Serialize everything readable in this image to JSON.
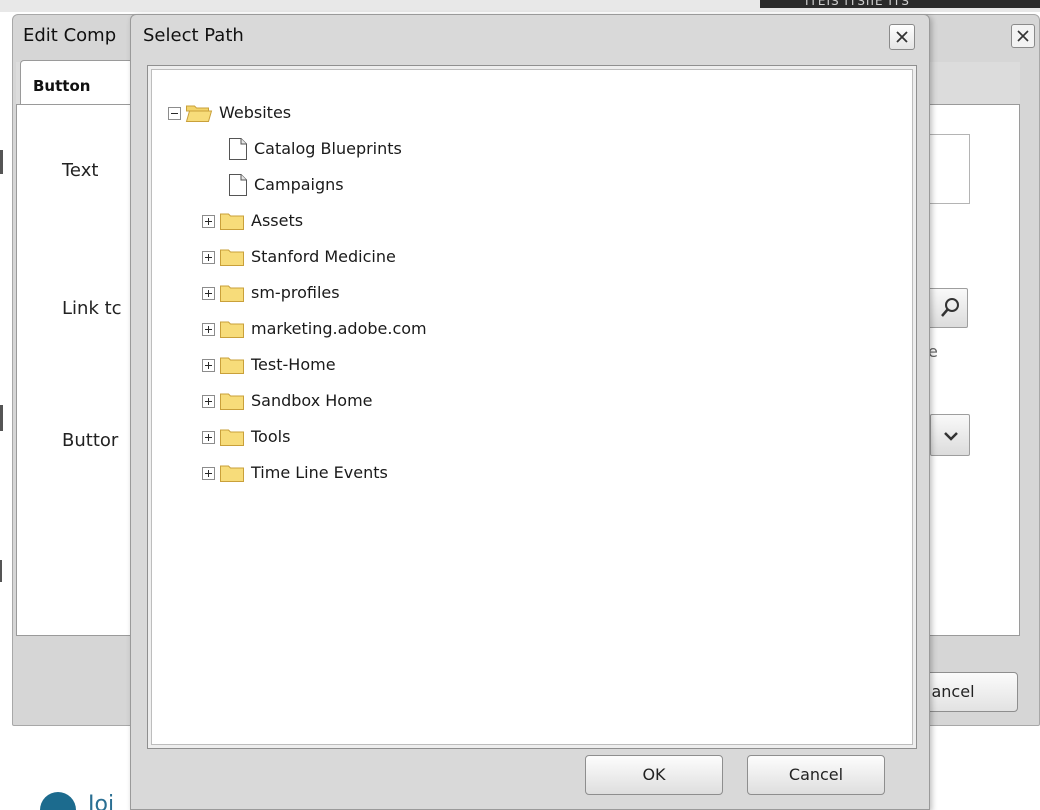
{
  "page": {
    "top_strip_text": "ITEIS ITSIIE     ITS",
    "footer_link": "Joi"
  },
  "edit_dialog": {
    "title": "Edit Comp",
    "tab_label": "Button",
    "fields": {
      "text_label": "Text",
      "link_label": "Link tc",
      "button_label": "Buttor"
    },
    "hint_fragment": "e",
    "cancel_label": "ancel"
  },
  "select_path_dialog": {
    "title": "Select Path",
    "tree": {
      "root": {
        "label": "Websites",
        "expanded": true,
        "icon": "folder-open-icon"
      },
      "pages": [
        {
          "label": "Catalog Blueprints",
          "icon": "page-icon"
        },
        {
          "label": "Campaigns",
          "icon": "page-icon"
        }
      ],
      "folders": [
        {
          "label": "Assets",
          "icon": "folder-icon"
        },
        {
          "label": "Stanford Medicine",
          "icon": "folder-icon"
        },
        {
          "label": "sm-profiles",
          "icon": "folder-icon"
        },
        {
          "label": "marketing.adobe.com",
          "icon": "folder-icon"
        },
        {
          "label": "Test-Home",
          "icon": "folder-icon"
        },
        {
          "label": "Sandbox Home",
          "icon": "folder-icon"
        },
        {
          "label": "Tools",
          "icon": "folder-icon"
        },
        {
          "label": "Time Line Events",
          "icon": "folder-icon"
        }
      ]
    },
    "ok_label": "OK",
    "cancel_label": "Cancel"
  },
  "colors": {
    "folder_fill": "#f7dc7a",
    "folder_stroke": "#c9a03a",
    "dialog_bg": "#d9d9d9",
    "link_blue": "#2a6f93"
  }
}
